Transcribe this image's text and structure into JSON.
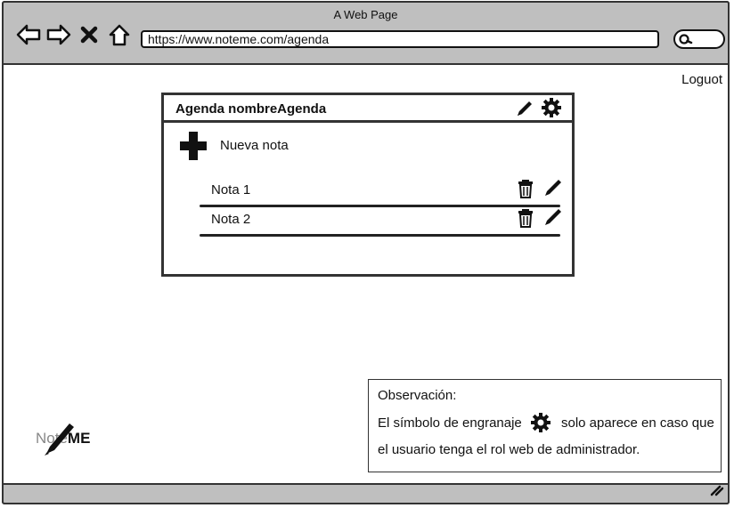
{
  "browser": {
    "window_title": "A Web Page",
    "url": "https://www.noteme.com/agenda",
    "back_icon": "arrow-left-icon",
    "forward_icon": "arrow-right-icon",
    "stop_icon": "close-icon",
    "home_icon": "home-icon",
    "search_icon": "search-icon"
  },
  "header": {
    "logout_label": "Loguot"
  },
  "agenda": {
    "title": "Agenda nombreAgenda",
    "edit_icon": "pencil-icon",
    "settings_icon": "gear-icon",
    "new_note": {
      "icon": "plus-icon",
      "label": "Nueva nota"
    },
    "notes": [
      {
        "label": "Nota 1",
        "delete_icon": "trash-icon",
        "edit_icon": "pencil-icon"
      },
      {
        "label": "Nota 2",
        "delete_icon": "trash-icon",
        "edit_icon": "pencil-icon"
      }
    ]
  },
  "logo": {
    "text_light": "Note",
    "text_bold": "ME",
    "icon": "pen-icon"
  },
  "observation": {
    "title": "Observación:",
    "line1_before": "El símbolo de engranaje",
    "line1_after": "solo aparece en caso que",
    "line2": "el usuario tenga el rol web de administrador.",
    "icon": "gear-icon"
  },
  "colors": {
    "chrome": "#bfbfbf",
    "ink": "#111111"
  }
}
